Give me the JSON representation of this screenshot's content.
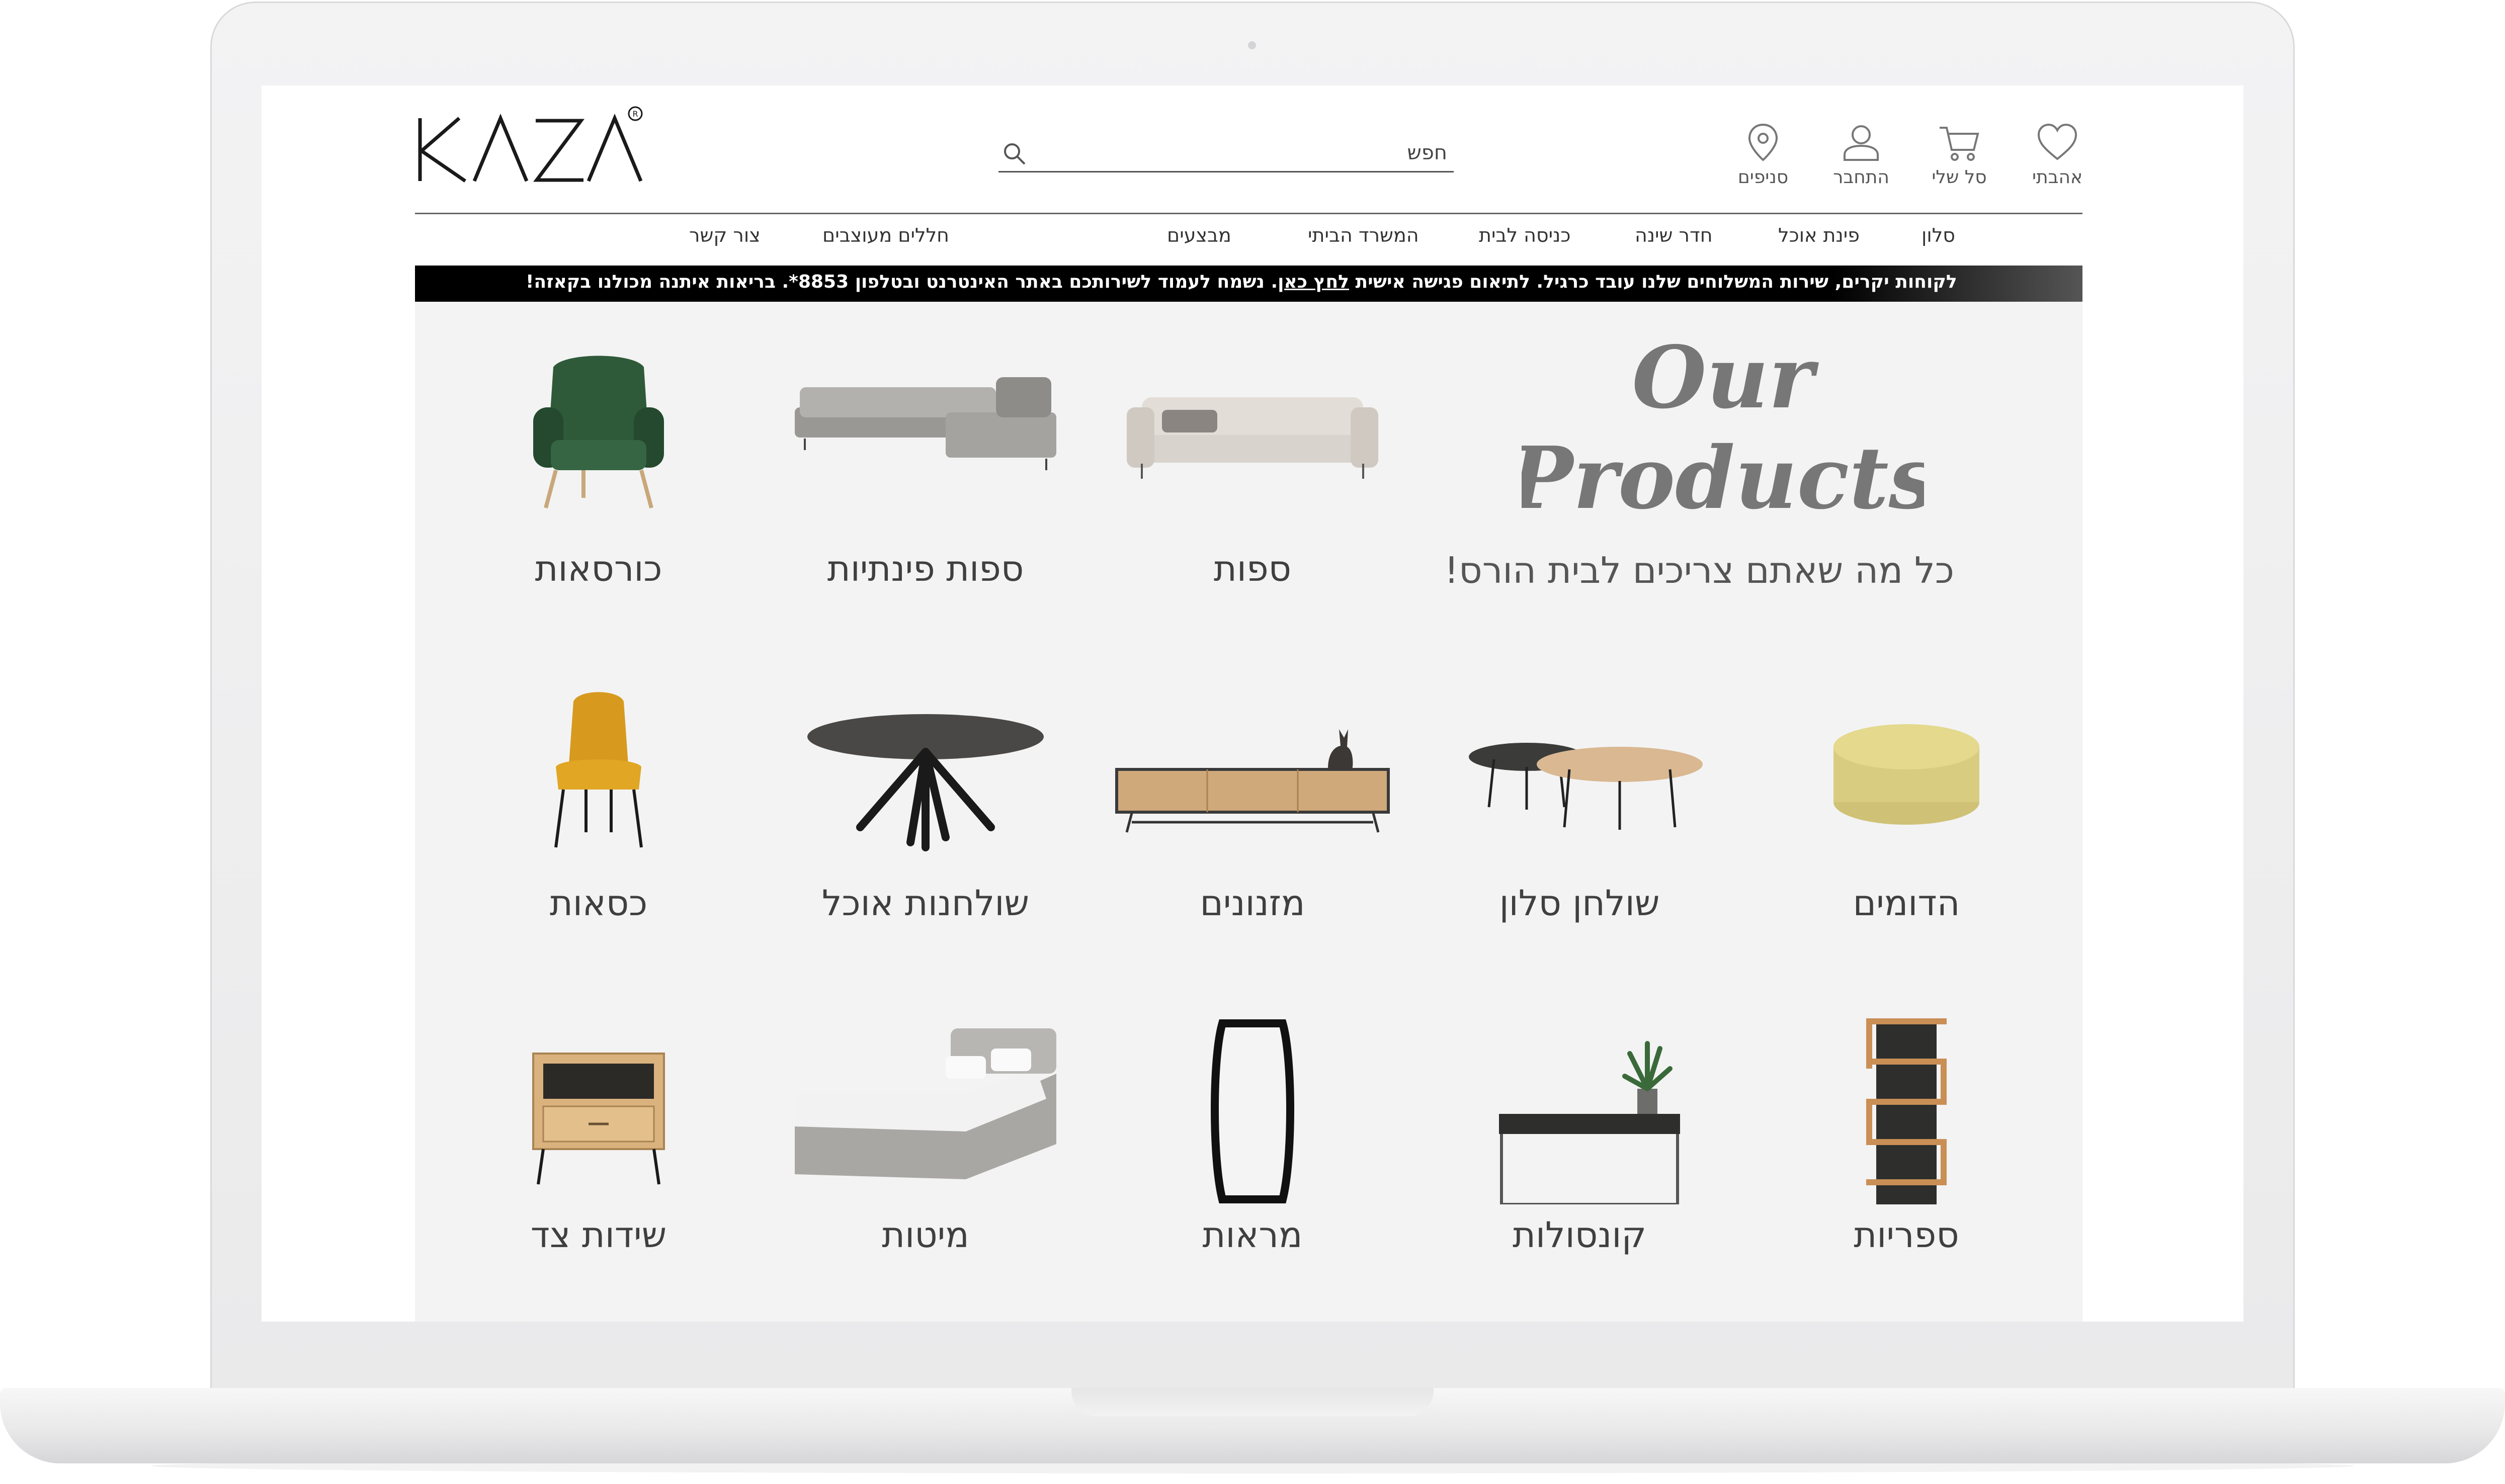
{
  "brand": {
    "logo_text": "KAZA",
    "registered_mark": "®"
  },
  "header": {
    "icons": [
      {
        "name": "heart-icon",
        "label": "אהבתי"
      },
      {
        "name": "cart-icon",
        "label": "סל שלי"
      },
      {
        "name": "user-icon",
        "label": "התחבר"
      },
      {
        "name": "location-pin-icon",
        "label": "סניפים"
      }
    ],
    "search": {
      "placeholder": "חפש",
      "icon": "search-icon"
    }
  },
  "main_nav": [
    "סלון",
    "פינת אוכל",
    "חדר שינה",
    "כניסה לבית",
    "המשרד הביתי",
    "מבצעים",
    "חללים מעוצבים",
    "צור קשר"
  ],
  "announcement": {
    "before_link": "לקוחות יקרים, שירות המשלוחים שלנו עובד כרגיל. לתיאום פגישה אישית",
    "link": "לחץ כאן",
    "after_link": ". נשמח לעמוד לשירותכם באתר האינטרנט ובטלפון 8853*. בריאות איתנה מכולנו בקאזה!"
  },
  "hero": {
    "script_line1": "Our",
    "script_line2": "Products",
    "subtitle": "כל מה שאתם צריכים לבית הורס!"
  },
  "categories": [
    {
      "label": "ספות",
      "icon": "sofa-icon"
    },
    {
      "label": "ספות פינתיות",
      "icon": "corner-sofa-icon"
    },
    {
      "label": "כורסאות",
      "icon": "armchair-icon"
    },
    {
      "label": "הדומים",
      "icon": "pouf-icon"
    },
    {
      "label": "שולחן סלון",
      "icon": "coffee-table-icon"
    },
    {
      "label": "מזנונים",
      "icon": "tv-stand-icon"
    },
    {
      "label": "שולחנות אוכל",
      "icon": "dining-table-icon"
    },
    {
      "label": "כסאות",
      "icon": "chair-icon"
    },
    {
      "label": "ספריות",
      "icon": "bookshelf-icon"
    },
    {
      "label": "קונסולות",
      "icon": "console-icon"
    },
    {
      "label": "מראות",
      "icon": "mirror-icon"
    },
    {
      "label": "מיטות",
      "icon": "bed-icon"
    },
    {
      "label": "שידות צד",
      "icon": "nightstand-icon"
    }
  ]
}
